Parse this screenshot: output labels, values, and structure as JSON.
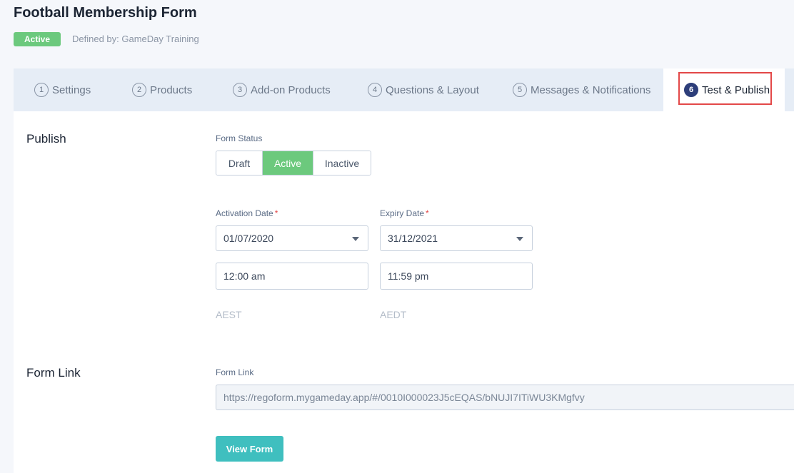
{
  "header": {
    "title": "Football Membership Form",
    "status_badge": "Active",
    "defined_by": "Defined by: GameDay Training"
  },
  "tabs": [
    {
      "num": "1",
      "label": "Settings"
    },
    {
      "num": "2",
      "label": "Products"
    },
    {
      "num": "3",
      "label": "Add-on Products"
    },
    {
      "num": "4",
      "label": "Questions & Layout"
    },
    {
      "num": "5",
      "label": "Messages & Notifications"
    },
    {
      "num": "6",
      "label": "Test & Publish",
      "active": true
    }
  ],
  "publish": {
    "section_title": "Publish",
    "form_status_label": "Form Status",
    "status_options": [
      "Draft",
      "Active",
      "Inactive"
    ],
    "selected_status": "Active",
    "activation_date_label": "Activation Date",
    "expiry_date_label": "Expiry Date",
    "required_marker": "*",
    "activation_date": "01/07/2020",
    "expiry_date": "31/12/2021",
    "activation_time": "12:00 am",
    "expiry_time": "11:59 pm",
    "activation_tz": "AEST",
    "expiry_tz": "AEDT"
  },
  "form_link": {
    "section_title": "Form Link",
    "field_label": "Form Link",
    "url": "https://regoform.mygameday.app/#/0010I000023J5cEQAS/bNUJI7ITiWU3KMgfvy",
    "view_button": "View Form"
  },
  "colors": {
    "active_green": "#6cc97d",
    "highlight_red": "#e34848",
    "view_button_teal": "#3fbfbf",
    "active_tab_num": "#2d3e7a"
  }
}
